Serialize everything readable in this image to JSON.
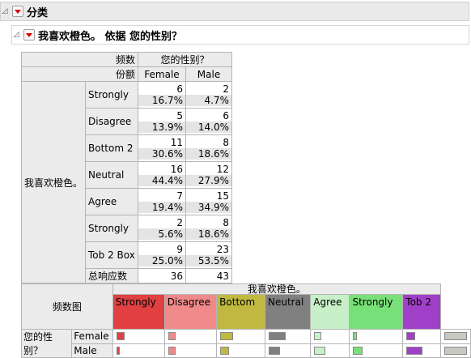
{
  "outline": {
    "level1": "分类",
    "level2": "我喜欢橙色。 依据 您的性别？"
  },
  "crosstab": {
    "corner_labels": [
      "频数",
      "份额"
    ],
    "col_header": "您的性别？",
    "columns": [
      "Female",
      "Male"
    ],
    "row_group": "我喜欢橙色。",
    "rows": [
      {
        "label": "Strongly",
        "female_count": "6",
        "female_pct": "16.7%",
        "male_count": "2",
        "male_pct": "4.7%"
      },
      {
        "label": "Disagree",
        "female_count": "5",
        "female_pct": "13.9%",
        "male_count": "6",
        "male_pct": "14.0%"
      },
      {
        "label": "Bottom 2",
        "female_count": "11",
        "female_pct": "30.6%",
        "male_count": "8",
        "male_pct": "18.6%"
      },
      {
        "label": "Neutral",
        "female_count": "16",
        "female_pct": "44.4%",
        "male_count": "12",
        "male_pct": "27.9%"
      },
      {
        "label": "Agree",
        "female_count": "7",
        "female_pct": "19.4%",
        "male_count": "15",
        "male_pct": "34.9%"
      },
      {
        "label": "Strongly",
        "female_count": "2",
        "female_pct": "5.6%",
        "male_count": "8",
        "male_pct": "18.6%"
      },
      {
        "label": "Tob 2 Box",
        "female_count": "9",
        "female_pct": "25.0%",
        "male_count": "23",
        "male_pct": "53.5%"
      }
    ],
    "total_label": "总响应数",
    "total_female": "36",
    "total_male": "43"
  },
  "mosaic": {
    "corner_label": "频数图",
    "col_header": "我喜欢橙色。",
    "levels": [
      {
        "label": "Strongly",
        "color": "#e04040"
      },
      {
        "label": "Disagree",
        "color": "#f08a8a"
      },
      {
        "label": "Bottom",
        "color": "#c0b840"
      },
      {
        "label": "Neutral",
        "color": "#808080"
      },
      {
        "label": "Agree",
        "color": "#c8f0c8"
      },
      {
        "label": "Strongly",
        "color": "#78e078"
      },
      {
        "label": "Tob 2",
        "color": "#a040c8"
      },
      {
        "label": "",
        "color": "#ffffff"
      }
    ],
    "row_group": "您的性别？",
    "rows": [
      {
        "label": "Female",
        "fractions": [
          0.167,
          0.139,
          0.306,
          0.444,
          0.194,
          0.056,
          0.25,
          0.5
        ]
      },
      {
        "label": "Male",
        "fractions": [
          0.047,
          0.14,
          0.186,
          0.279,
          0.349,
          0.186,
          0.535,
          0.5
        ]
      }
    ],
    "extra_bar_color": "#c8c8c0"
  }
}
